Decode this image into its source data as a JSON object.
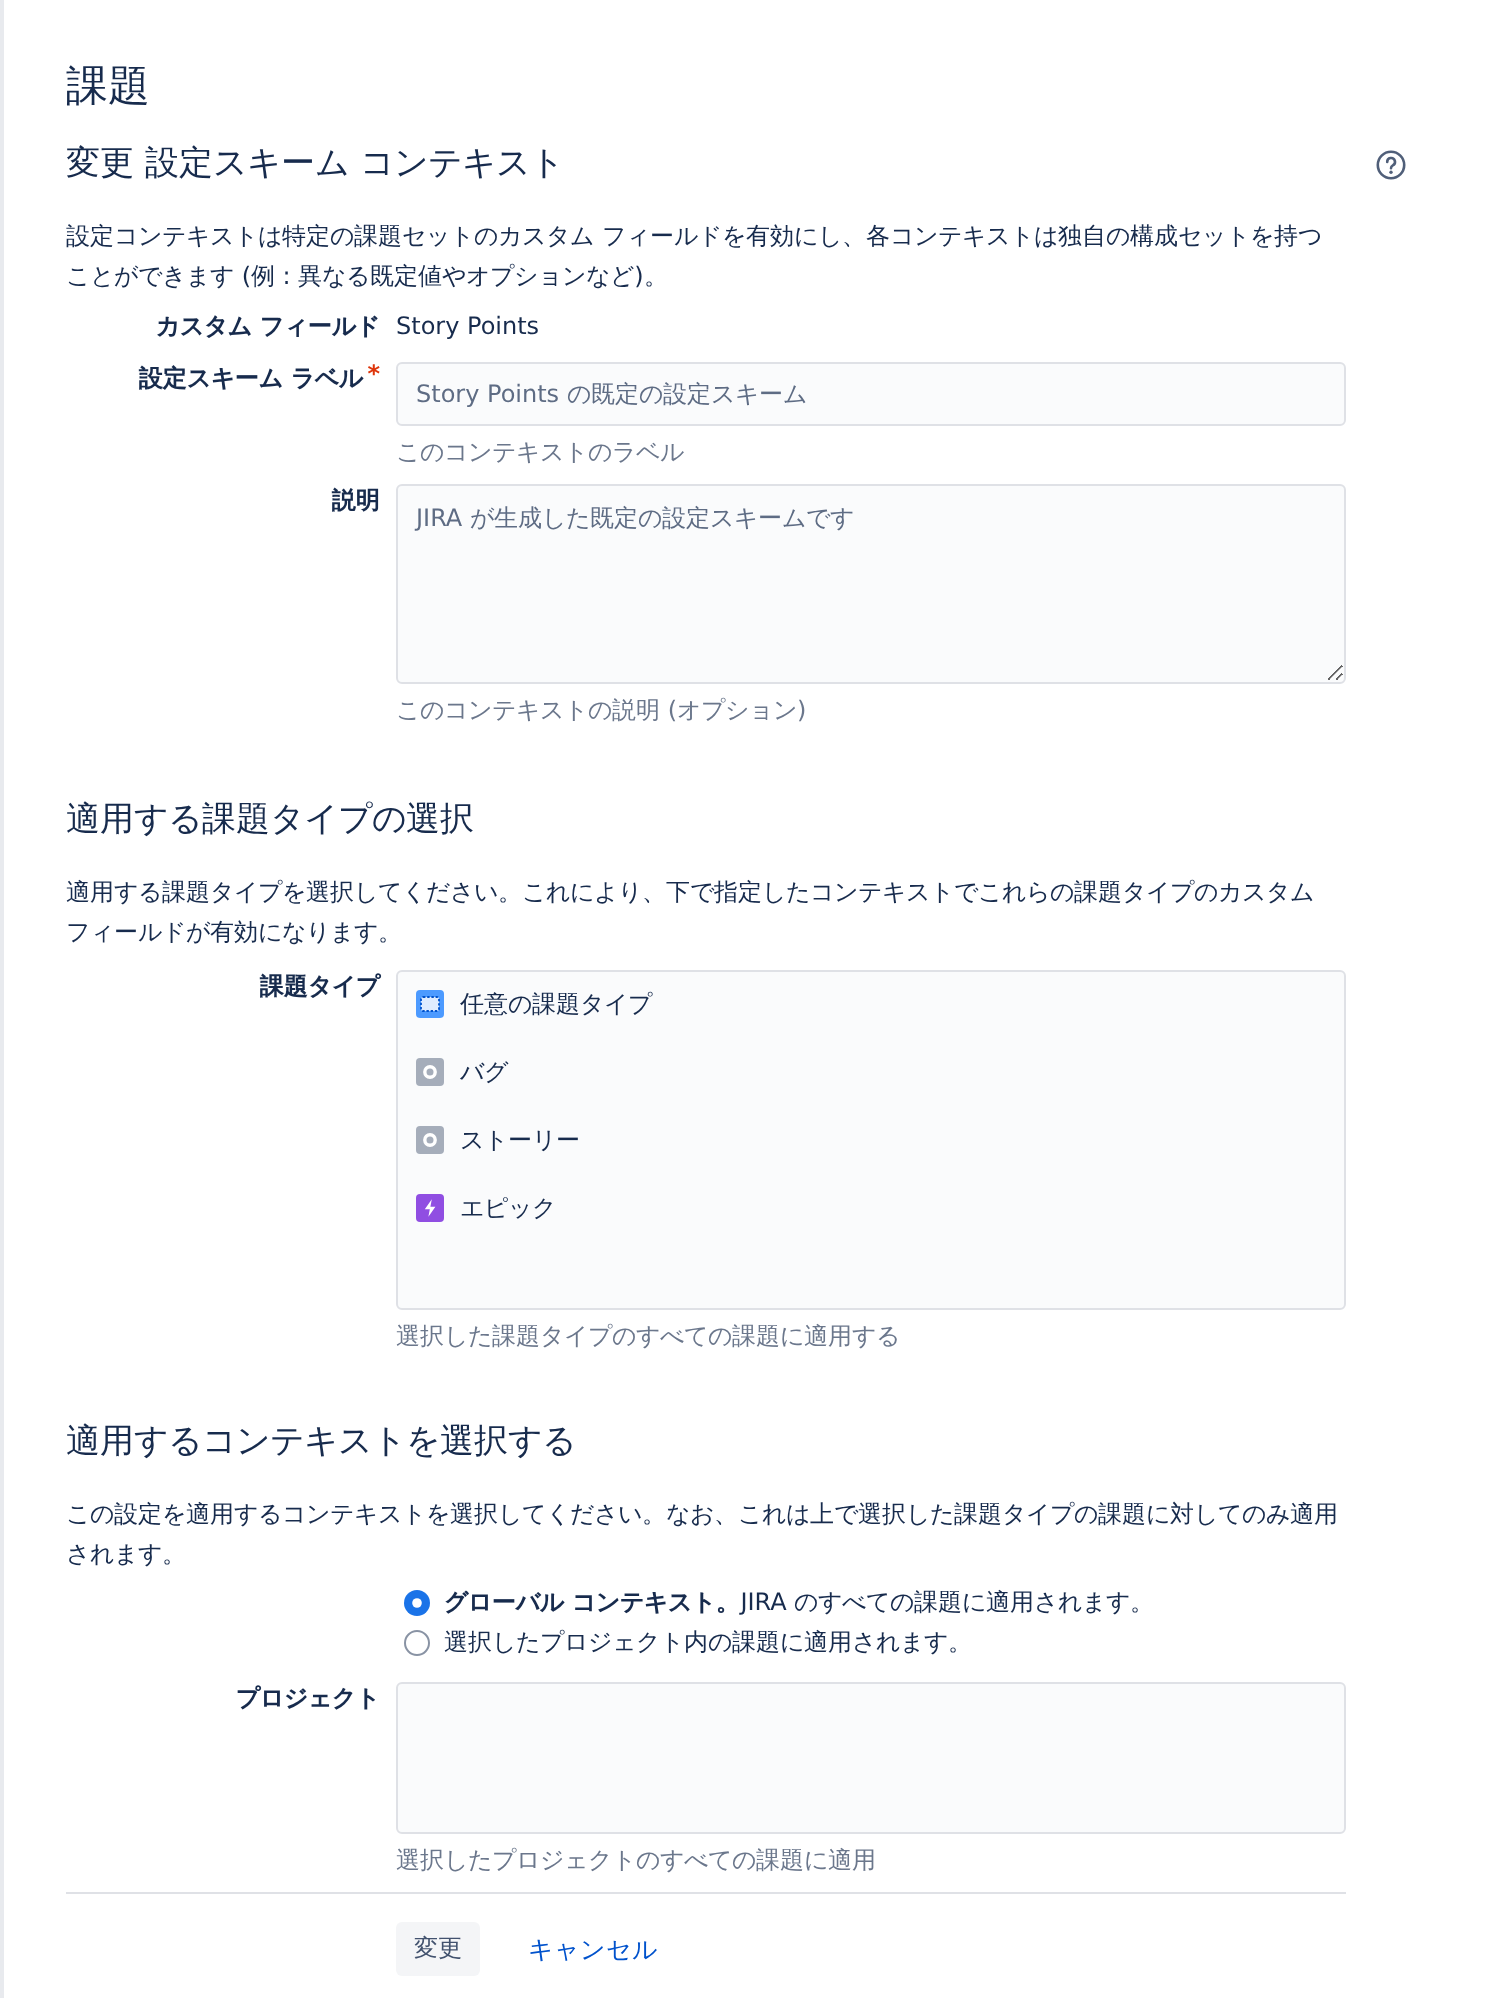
{
  "page_title": "課題",
  "config_section": {
    "heading": "変更 設定スキーム コンテキスト",
    "help_icon": true,
    "description": "設定コンテキストは特定の課題セットのカスタム フィールドを有効にし、各コンテキストは独自の構成セットを持つことができます (例 : 異なる既定値やオプションなど)。",
    "custom_field": {
      "label": "カスタム フィールド",
      "value": "Story Points"
    },
    "scheme_label_field": {
      "label": "設定スキーム ラベル",
      "required_mark": "*",
      "value": "Story Points の既定の設定スキーム",
      "help": "このコンテキストのラベル"
    },
    "description_field": {
      "label": "説明",
      "value": "JIRA が生成した既定の設定スキームです",
      "help": "このコンテキストの説明 (オプション)"
    }
  },
  "issue_types_section": {
    "heading": "適用する課題タイプの選択",
    "description": "適用する課題タイプを選択してください。これにより、下で指定したコンテキストでこれらの課題タイプのカスタムフィールドが有効になります。",
    "issue_type_field": {
      "label": "課題タイプ",
      "options": [
        {
          "label": "任意の課題タイプ",
          "kind": "any",
          "selected": false
        },
        {
          "label": "バグ",
          "kind": "generic",
          "selected": false
        },
        {
          "label": "ストーリー",
          "kind": "generic",
          "selected": false
        },
        {
          "label": "エピック",
          "kind": "epic",
          "selected": false
        }
      ],
      "help": "選択した課題タイプのすべての課題に適用する"
    }
  },
  "context_section": {
    "heading": "適用するコンテキストを選択する",
    "description": "この設定を適用するコンテキストを選択してください。なお、これは上で選択した課題タイプの課題に対してのみ適用されます。",
    "scope_options": [
      {
        "label": "**グローバル コンテキスト。**JIRA のすべての課題に適用されます。",
        "selected": true
      },
      {
        "label": "選択したプロジェクト内の課題に適用されます。",
        "selected": false
      }
    ],
    "project_field": {
      "label": "プロジェクト",
      "help": "選択したプロジェクトのすべての課題に適用"
    }
  },
  "actions": {
    "submit": "変更",
    "cancel": "キャンセル"
  }
}
